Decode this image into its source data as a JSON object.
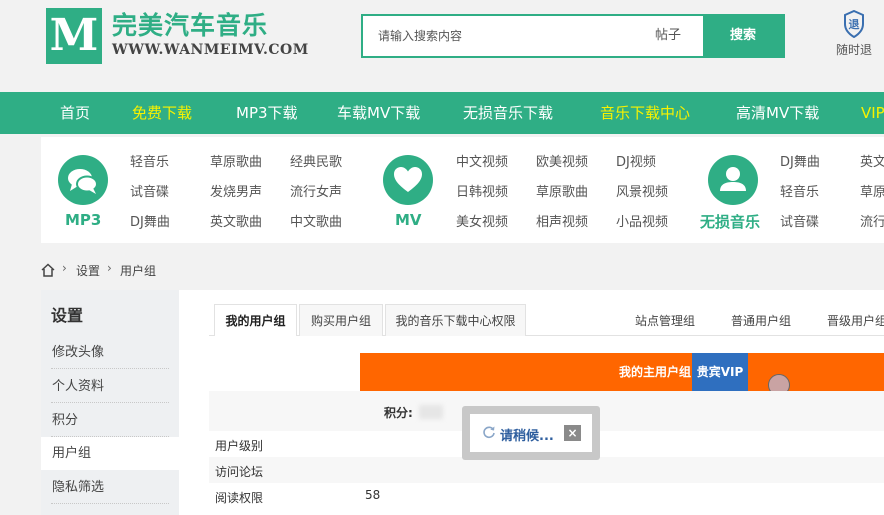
{
  "header": {
    "logo_letter": "M",
    "site_name": "完美汽车音乐",
    "site_url": "WWW.WANMEIMV.COM",
    "search_placeholder": "请输入搜索内容",
    "search_type": "帖子",
    "search_button": "搜索",
    "quit_label": "随时退"
  },
  "nav": {
    "items": [
      {
        "label": "首页"
      },
      {
        "label": "免费下载"
      },
      {
        "label": "MP3下载"
      },
      {
        "label": "车载MV下载"
      },
      {
        "label": "无损音乐下载"
      },
      {
        "label": "音乐下载中心"
      },
      {
        "label": "高清MV下载"
      },
      {
        "label": "VIP"
      }
    ],
    "highlight_color": "#f7f200"
  },
  "categories": {
    "mp3": {
      "title": "MP3",
      "links": [
        "轻音乐",
        "草原歌曲",
        "经典民歌",
        "试音碟",
        "发烧男声",
        "流行女声",
        "DJ舞曲",
        "英文歌曲",
        "中文歌曲"
      ]
    },
    "mv": {
      "title": "MV",
      "links": [
        "中文视频",
        "欧美视频",
        "DJ视频",
        "日韩视频",
        "草原歌曲",
        "风景视频",
        "美女视频",
        "相声视频",
        "小品视频"
      ]
    },
    "lossless": {
      "title": "无损音乐",
      "links": [
        "DJ舞曲",
        "英文",
        "轻音乐",
        "草原",
        "试音碟",
        "流行"
      ]
    }
  },
  "breadcrumb": {
    "items": [
      "设置",
      "用户组"
    ]
  },
  "sidebar": {
    "title": "设置",
    "items": [
      {
        "label": "修改头像"
      },
      {
        "label": "个人资料"
      },
      {
        "label": "积分"
      },
      {
        "label": "用户组"
      },
      {
        "label": "隐私筛选"
      }
    ]
  },
  "content": {
    "tabs": [
      {
        "label": "我的用户组"
      },
      {
        "label": "购买用户组"
      },
      {
        "label": "我的音乐下载中心权限"
      }
    ],
    "right_tabs": [
      "站点管理组",
      "普通用户组",
      "晋级用户组"
    ],
    "banner_text": "我的主用户组 - ",
    "banner_vip": "贵宾VIP",
    "score_label": "积分:",
    "rows": [
      {
        "label": "用户级别",
        "value": ""
      },
      {
        "label": "访问论坛",
        "value": ""
      },
      {
        "label": "阅读权限",
        "value": "58"
      }
    ]
  },
  "popup": {
    "text": "请稍候...",
    "close": "×"
  },
  "colors": {
    "brand": "#2fae85",
    "banner": "#ff6600",
    "vip": "#2f6fbf"
  }
}
